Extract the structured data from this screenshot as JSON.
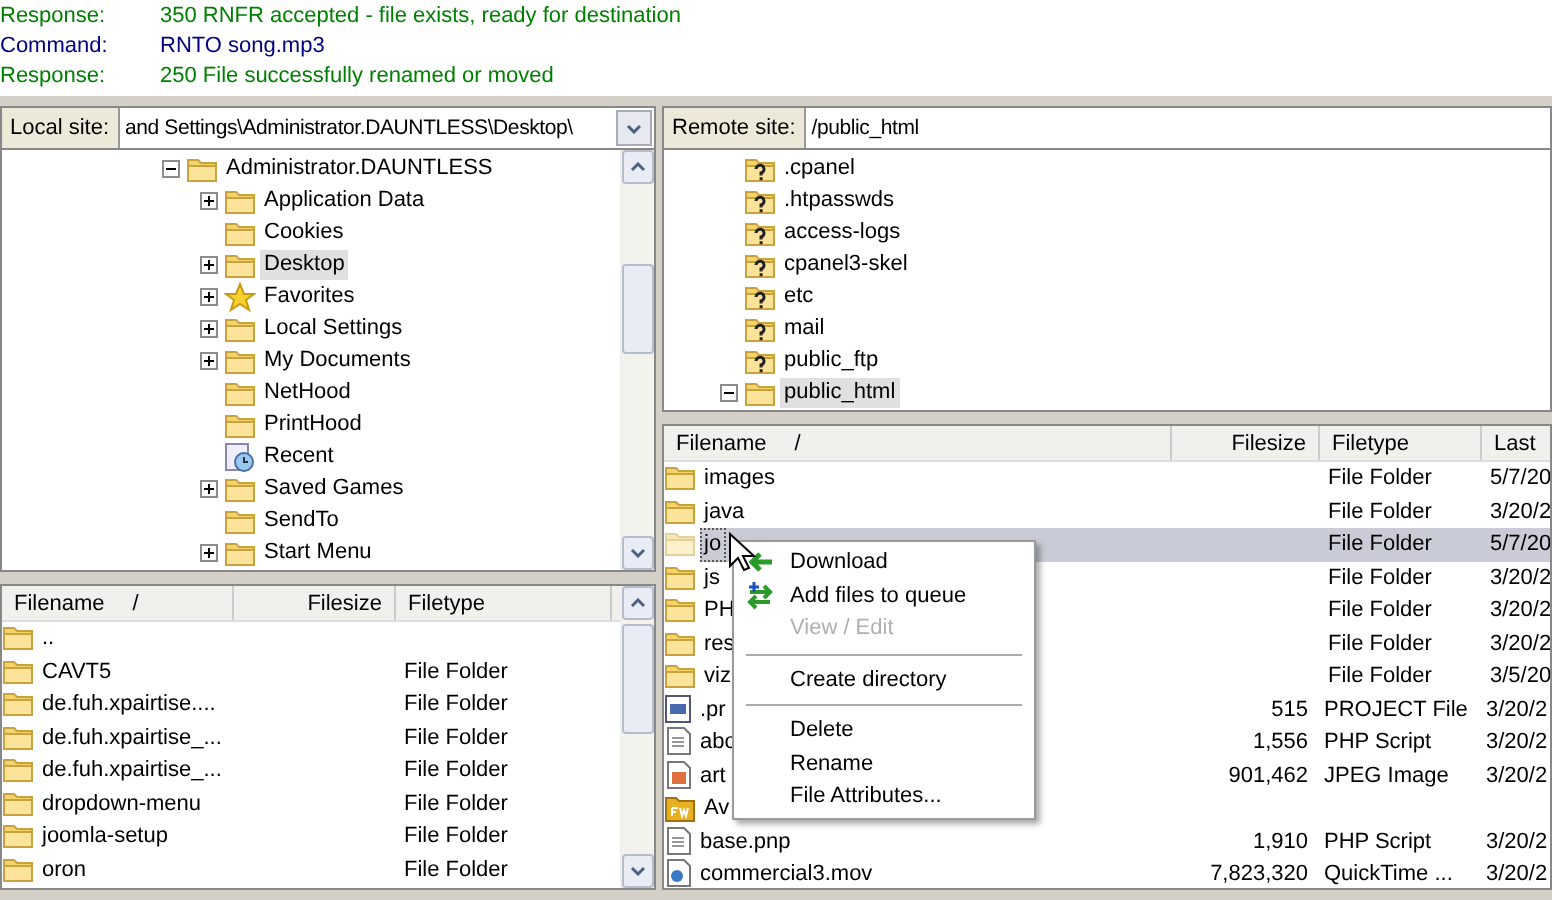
{
  "log": [
    {
      "kind": "response",
      "label": "Response:",
      "text": "350 RNFR accepted - file exists, ready for destination"
    },
    {
      "kind": "command",
      "label": "Command:",
      "text": "RNTO song.mp3"
    },
    {
      "kind": "response",
      "label": "Response:",
      "text": "250 File successfully renamed or moved"
    }
  ],
  "local_site": {
    "label": "Local site:",
    "path": "and Settings\\Administrator.DAUNTLESS\\Desktop\\"
  },
  "local_tree": [
    {
      "label": "Administrator.DAUNTLESS",
      "kind": "folder",
      "expandable": true,
      "expanded": true,
      "selected": false,
      "children": [
        {
          "label": "Application Data",
          "kind": "folder",
          "expandable": true,
          "expanded": false,
          "selected": false
        },
        {
          "label": "Cookies",
          "kind": "folder",
          "expandable": false,
          "selected": false
        },
        {
          "label": "Desktop",
          "kind": "folder",
          "expandable": true,
          "expanded": false,
          "selected": true
        },
        {
          "label": "Favorites",
          "kind": "star",
          "expandable": true,
          "expanded": false,
          "selected": false
        },
        {
          "label": "Local Settings",
          "kind": "folder",
          "expandable": true,
          "expanded": false,
          "selected": false
        },
        {
          "label": "My Documents",
          "kind": "folder",
          "expandable": true,
          "expanded": false,
          "selected": false
        },
        {
          "label": "NetHood",
          "kind": "folder",
          "expandable": false,
          "selected": false
        },
        {
          "label": "PrintHood",
          "kind": "folder",
          "expandable": false,
          "selected": false
        },
        {
          "label": "Recent",
          "kind": "recent",
          "expandable": false,
          "selected": false
        },
        {
          "label": "Saved Games",
          "kind": "folder",
          "expandable": true,
          "expanded": false,
          "selected": false
        },
        {
          "label": "SendTo",
          "kind": "folder",
          "expandable": false,
          "selected": false
        },
        {
          "label": "Start Menu",
          "kind": "folder",
          "expandable": true,
          "expanded": false,
          "selected": false
        }
      ]
    }
  ],
  "local_files": {
    "columns": [
      "Filename",
      "Filesize",
      "Filetype"
    ],
    "sort_mark": "/",
    "rows": [
      {
        "name": "..",
        "kind": "folder"
      },
      {
        "name": "CAVT5",
        "kind": "folder",
        "type": "File Folder"
      },
      {
        "name": "de.fuh.xpairtise....",
        "kind": "folder",
        "type": "File Folder"
      },
      {
        "name": "de.fuh.xpairtise_...",
        "kind": "folder",
        "type": "File Folder"
      },
      {
        "name": "de.fuh.xpairtise_...",
        "kind": "folder",
        "type": "File Folder"
      },
      {
        "name": "dropdown-menu",
        "kind": "folder",
        "type": "File Folder"
      },
      {
        "name": "joomla-setup",
        "kind": "folder",
        "type": "File Folder"
      },
      {
        "name": "oron",
        "kind": "folder",
        "type": "File Folder"
      }
    ]
  },
  "remote_site": {
    "label": "Remote site:",
    "path": "/public_html"
  },
  "remote_tree": [
    {
      "label": ".cpanel",
      "kind": "unknown",
      "expandable": false,
      "selected": false
    },
    {
      "label": ".htpasswds",
      "kind": "unknown",
      "expandable": false,
      "selected": false
    },
    {
      "label": "access-logs",
      "kind": "unknown",
      "expandable": false,
      "selected": false
    },
    {
      "label": "cpanel3-skel",
      "kind": "unknown",
      "expandable": false,
      "selected": false
    },
    {
      "label": "etc",
      "kind": "unknown",
      "expandable": false,
      "selected": false
    },
    {
      "label": "mail",
      "kind": "unknown",
      "expandable": false,
      "selected": false
    },
    {
      "label": "public_ftp",
      "kind": "unknown",
      "expandable": false,
      "selected": false
    },
    {
      "label": "public_html",
      "kind": "folder",
      "expandable": true,
      "expanded": true,
      "selected": true
    }
  ],
  "remote_files": {
    "columns": [
      "Filename",
      "Filesize",
      "Filetype",
      "Last"
    ],
    "sort_mark": "/",
    "rows": [
      {
        "name": "images",
        "kind": "folder",
        "type": "File Folder",
        "date": "5/7/20",
        "selected": false
      },
      {
        "name": "java",
        "kind": "folder",
        "type": "File Folder",
        "date": "3/20/2",
        "selected": false
      },
      {
        "name": "jo",
        "kind": "folder",
        "type": "File Folder",
        "date": "5/7/20",
        "selected": true
      },
      {
        "name": "js",
        "kind": "folder",
        "type": "File Folder",
        "date": "3/20/2",
        "selected": false
      },
      {
        "name": "PH",
        "kind": "folder",
        "type": "File Folder",
        "date": "3/20/2",
        "selected": false
      },
      {
        "name": "res",
        "kind": "folder",
        "type": "File Folder",
        "date": "3/20/2",
        "selected": false
      },
      {
        "name": "viz",
        "kind": "folder",
        "type": "File Folder",
        "date": "3/5/20",
        "selected": false
      },
      {
        "name": ".pr",
        "kind": "project",
        "size": "515",
        "type": "PROJECT File",
        "date": "3/20/2",
        "selected": false
      },
      {
        "name": "abo",
        "kind": "script",
        "size": "1,556",
        "type": "PHP Script",
        "date": "3/20/2",
        "selected": false
      },
      {
        "name": "art",
        "kind": "image",
        "size": "901,462",
        "type": "JPEG Image",
        "date": "3/20/2",
        "selected": false
      },
      {
        "name": "Av",
        "kind": "fireworks",
        "selected": false
      },
      {
        "name": "base.pnp",
        "kind": "script",
        "size": "1,910",
        "type": "PHP Script",
        "date": "3/20/2",
        "selected": false
      },
      {
        "name": "commercial3.mov",
        "kind": "movie",
        "size": "7,823,320",
        "type": "QuickTime ...",
        "date": "3/20/2",
        "selected": false
      }
    ]
  },
  "context_menu": [
    {
      "kind": "download",
      "label": "Download",
      "disabled": false
    },
    {
      "kind": "queue",
      "label": "Add files to queue",
      "disabled": false
    },
    {
      "kind": "plain",
      "label": "View / Edit",
      "disabled": true
    },
    {
      "kind": "separator"
    },
    {
      "kind": "plain",
      "label": "Create directory",
      "disabled": false
    },
    {
      "kind": "separator"
    },
    {
      "kind": "plain",
      "label": "Delete",
      "disabled": false
    },
    {
      "kind": "plain",
      "label": "Rename",
      "disabled": false
    },
    {
      "kind": "plain",
      "label": "File Attributes...",
      "disabled": false
    }
  ]
}
